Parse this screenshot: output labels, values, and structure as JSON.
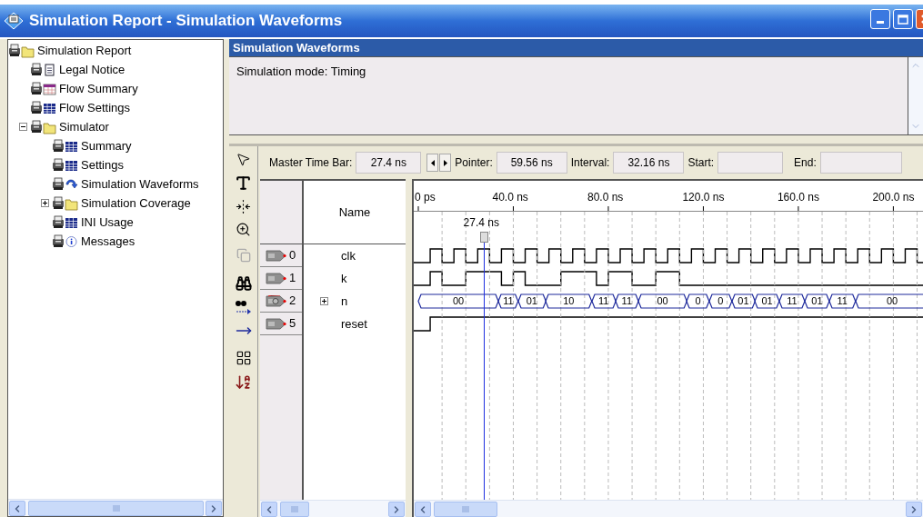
{
  "window": {
    "title": "Simulation Report - Simulation Waveforms"
  },
  "tree": [
    {
      "label": "Simulation Report",
      "kind": "folder",
      "children": [
        {
          "label": "Legal Notice",
          "kind": "document"
        },
        {
          "label": "Flow Summary",
          "kind": "report-table"
        },
        {
          "label": "Flow Settings",
          "kind": "table"
        },
        {
          "label": "Simulator",
          "kind": "folder",
          "expanded": true,
          "children": [
            {
              "label": "Summary",
              "kind": "table"
            },
            {
              "label": "Settings",
              "kind": "table"
            },
            {
              "label": "Simulation Waveforms",
              "kind": "waveform"
            },
            {
              "label": "Simulation Coverage",
              "kind": "folder",
              "expanded": false
            },
            {
              "label": "INI Usage",
              "kind": "table"
            },
            {
              "label": "Messages",
              "kind": "info"
            }
          ]
        }
      ]
    }
  ],
  "panel": {
    "title": "Simulation Waveforms",
    "text": "Simulation mode: Timing"
  },
  "time_bar": {
    "master_label": "Master Time Bar:",
    "master_value": "27.4 ns",
    "pointer_label": "Pointer:",
    "pointer_value": "59.56 ns",
    "interval_label": "Interval:",
    "interval_value": "32.16 ns",
    "start_label": "Start:",
    "end_label": "End:"
  },
  "table": {
    "name_header": "Name"
  },
  "ruler": {
    "labels": [
      "0 ps",
      "40.0 ns",
      "80.0 ns",
      "120.0 ns",
      "160.0 ns",
      "200.0 ns"
    ],
    "cursor_label": "27.4 ns"
  },
  "signals": [
    {
      "index": "0",
      "name": "clk",
      "kind": "input"
    },
    {
      "index": "1",
      "name": "k",
      "kind": "input"
    },
    {
      "index": "2",
      "name": "n",
      "kind": "bus",
      "expanded": false,
      "values": [
        "00",
        "11",
        "01",
        "10",
        "11",
        "11",
        "00",
        "0",
        "0",
        "01",
        "01",
        "11",
        "01",
        "11",
        "00"
      ]
    },
    {
      "index": "5",
      "name": "reset",
      "kind": "input"
    }
  ]
}
